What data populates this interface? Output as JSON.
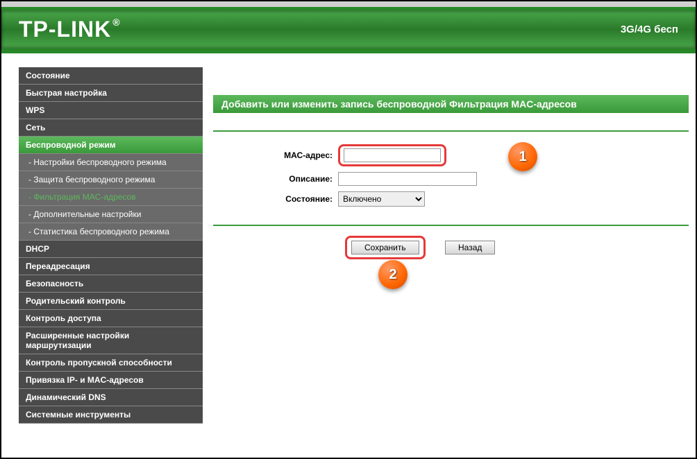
{
  "header": {
    "logo": "TP-LINK",
    "logo_reg": "®",
    "right_text": "3G/4G бесп"
  },
  "sidebar": {
    "items": [
      {
        "label": "Состояние",
        "type": "main"
      },
      {
        "label": "Быстрая настройка",
        "type": "main"
      },
      {
        "label": "WPS",
        "type": "main"
      },
      {
        "label": "Сеть",
        "type": "main"
      },
      {
        "label": "Беспроводной режим",
        "type": "main_active"
      },
      {
        "label": "- Настройки беспроводного режима",
        "type": "sub"
      },
      {
        "label": "- Защита беспроводного режима",
        "type": "sub"
      },
      {
        "label": "- Фильтрация MAC-адресов",
        "type": "sub_active"
      },
      {
        "label": "- Дополнительные настройки",
        "type": "sub"
      },
      {
        "label": "- Статистика беспроводного режима",
        "type": "sub"
      },
      {
        "label": "DHCP",
        "type": "main"
      },
      {
        "label": "Переадресация",
        "type": "main"
      },
      {
        "label": "Безопасность",
        "type": "main"
      },
      {
        "label": "Родительский контроль",
        "type": "main"
      },
      {
        "label": "Контроль доступа",
        "type": "main"
      },
      {
        "label": "Расширенные настройки маршрутизации",
        "type": "main"
      },
      {
        "label": "Контроль пропускной способности",
        "type": "main"
      },
      {
        "label": "Привязка IP- и MAC-адресов",
        "type": "main"
      },
      {
        "label": "Динамический DNS",
        "type": "main"
      },
      {
        "label": "Системные инструменты",
        "type": "main"
      }
    ]
  },
  "content": {
    "title": "Добавить или изменить запись беспроводной Фильтрация MAC-адресов",
    "form": {
      "mac_label": "МАС-адрес:",
      "mac_value": "",
      "desc_label": "Описание:",
      "desc_value": "",
      "state_label": "Состояние:",
      "state_value": "Включено"
    },
    "buttons": {
      "save": "Сохранить",
      "back": "Назад"
    }
  },
  "callouts": {
    "one": "1",
    "two": "2"
  }
}
